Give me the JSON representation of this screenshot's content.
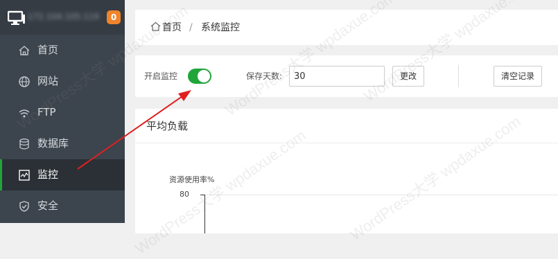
{
  "sidebar": {
    "server_ip": "172.104.105.119",
    "notification_count": "0",
    "items": [
      {
        "label": "首页",
        "icon": "home-icon"
      },
      {
        "label": "网站",
        "icon": "globe-icon"
      },
      {
        "label": "FTP",
        "icon": "ftp-icon"
      },
      {
        "label": "数据库",
        "icon": "database-icon"
      },
      {
        "label": "监控",
        "icon": "monitor-chart-icon",
        "active": true
      },
      {
        "label": "安全",
        "icon": "shield-icon"
      }
    ]
  },
  "breadcrumb": {
    "home": "首页",
    "separator": "/",
    "current": "系统监控"
  },
  "controls": {
    "monitor_label": "开启监控",
    "monitor_enabled": true,
    "days_label": "保存天数:",
    "days_value": "30",
    "change_button": "更改",
    "clear_button": "清空记录"
  },
  "panel": {
    "title": "平均负载"
  },
  "chart_data": {
    "type": "line",
    "title": "",
    "ylabel": "资源使用率%",
    "y_ticks": [
      "80"
    ],
    "series": []
  },
  "watermark_text": "WordPress大学 wpdaxue.com",
  "colors": {
    "accent_green": "#20a53a",
    "sidebar_bg": "#3c444d",
    "badge_orange": "#f0842b",
    "arrow_red": "#e02020"
  }
}
